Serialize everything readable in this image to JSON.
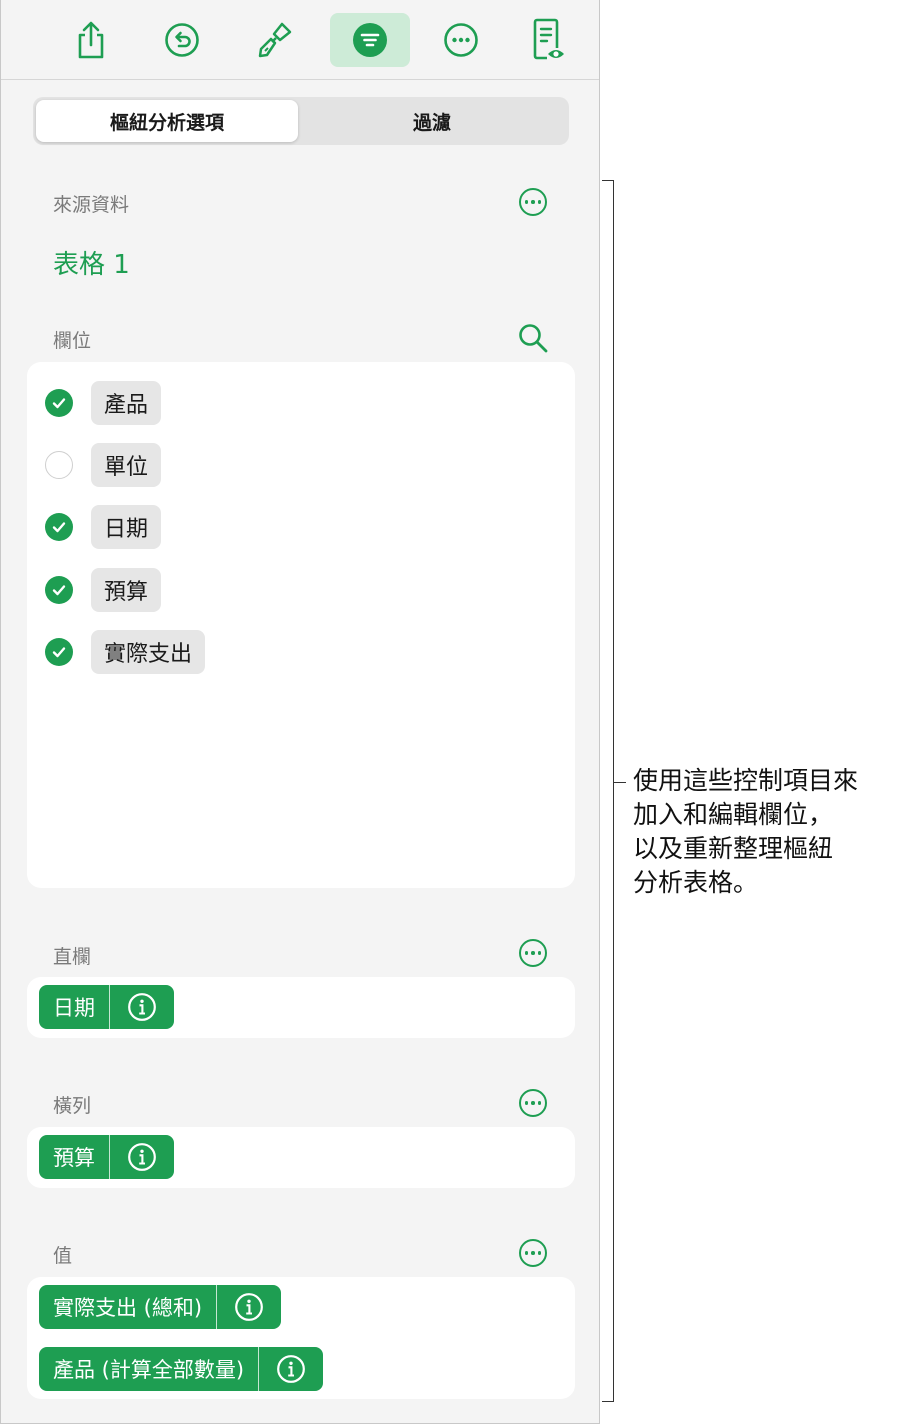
{
  "toolbar": {
    "buttons": [
      {
        "icon": "share-icon"
      },
      {
        "icon": "undo-icon"
      },
      {
        "icon": "format-brush-icon"
      },
      {
        "icon": "organize-icon",
        "active": true
      },
      {
        "icon": "more-icon"
      },
      {
        "icon": "reading-view-icon"
      }
    ]
  },
  "tabs": {
    "pivot_options": "樞紐分析選項",
    "filter": "過濾"
  },
  "source": {
    "label": "來源資料",
    "table_name": "表格 1"
  },
  "fields": {
    "label": "欄位",
    "items": [
      {
        "name": "產品",
        "checked": true
      },
      {
        "name": "單位",
        "checked": false
      },
      {
        "name": "日期",
        "checked": true
      },
      {
        "name": "預算",
        "checked": true
      },
      {
        "name": "實際支出",
        "checked": true
      }
    ]
  },
  "columns": {
    "label": "直欄",
    "pills": [
      "日期"
    ]
  },
  "rows": {
    "label": "橫列",
    "pills": [
      "預算"
    ]
  },
  "values": {
    "label": "值",
    "pills": [
      "實際支出 (總和)",
      "產品 (計算全部數量)"
    ]
  },
  "callout": {
    "lines": [
      "使用這些控制項目來",
      "加入和編輯欄位，",
      "以及重新整理樞紐",
      "分析表格。"
    ]
  },
  "colors": {
    "accent": "#1e9e52",
    "accent_light": "#cdebd7",
    "panel_bg": "#f4f4f4"
  }
}
